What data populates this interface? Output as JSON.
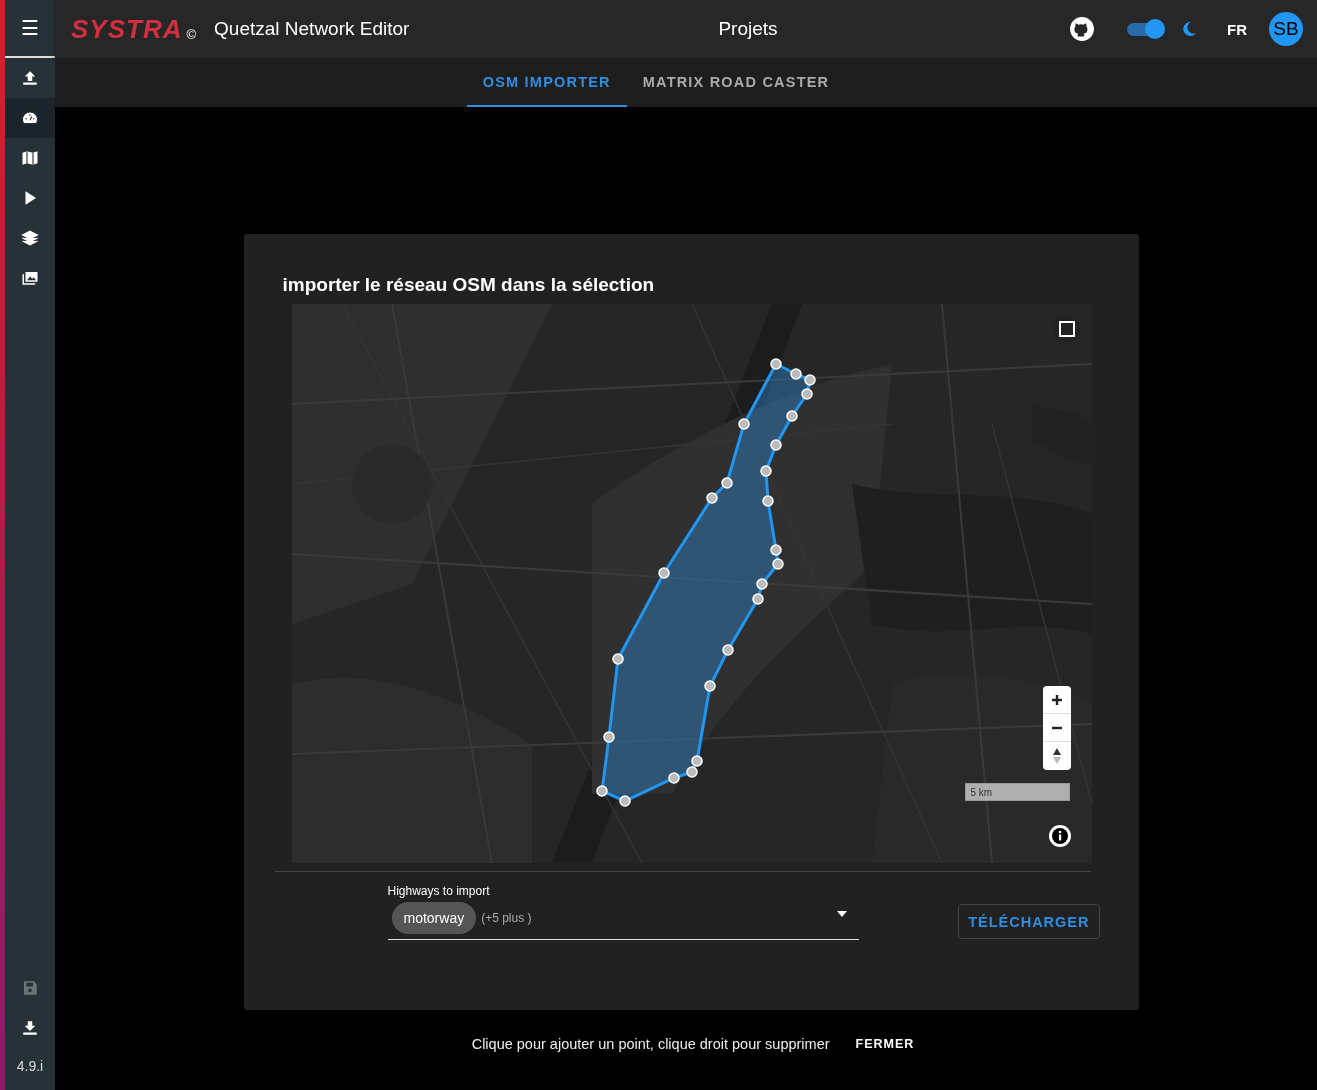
{
  "sidebar": {
    "menu": "☰",
    "items": [
      {
        "kind": "upload",
        "selected": false
      },
      {
        "kind": "gauge",
        "selected": true
      },
      {
        "kind": "map",
        "selected": false
      },
      {
        "kind": "play",
        "selected": false
      },
      {
        "kind": "layers",
        "selected": false
      },
      {
        "kind": "images",
        "selected": false
      }
    ],
    "bottom_items": [
      {
        "kind": "save",
        "disabled": true
      },
      {
        "kind": "download",
        "disabled": false
      }
    ],
    "version": "4.9.i"
  },
  "app_bar": {
    "logo": "SYSTRA",
    "copyright": "©",
    "app_title": "Quetzal Network Editor",
    "page_title": "Projets",
    "dark_mode_on": true,
    "language": "FR",
    "avatar": "SB"
  },
  "tabs": [
    {
      "label": "OSM IMPORTER",
      "selected": true
    },
    {
      "label": "MATRIX ROAD CASTER",
      "selected": false
    }
  ],
  "dialog": {
    "title": "importer le réseau OSM dans la sélection",
    "map": {
      "kind": "picture",
      "scale": "5 km"
    },
    "highways_select": {
      "label": "Highways to import",
      "chip": "motorway",
      "more": "(+5 plus )"
    },
    "download_button": "TÉLÉCHARGER"
  },
  "snackbar": {
    "message": "Clique pour ajouter un point, clique droit pour supprimer",
    "action": "FERMER"
  }
}
